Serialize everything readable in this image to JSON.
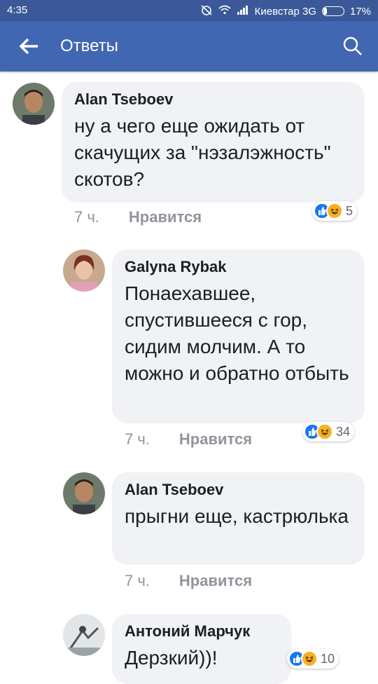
{
  "status": {
    "time": "4:35",
    "carrier": "Киевстар 3G",
    "battery": "17%",
    "battery_level": 0.17
  },
  "header": {
    "title": "Ответы"
  },
  "comments": [
    {
      "author": "Alan Tseboev",
      "text": "ну а чего еще ожидать от скачущих за \"нэзалэжность\" скотов?",
      "time": "7 ч.",
      "like_label": "Нравится",
      "reactions_count": "5"
    },
    {
      "author": "Galyna Rybak",
      "text": "Понаехавшее, спустившееся с гор, сидим молчим. А то можно и обратно отбыть",
      "time": "7 ч.",
      "like_label": "Нравится",
      "reactions_count": "34"
    },
    {
      "author": "Alan Tseboev",
      "text": "прыгни еще, кастрюлька",
      "time": "7 ч.",
      "like_label": "Нравится"
    },
    {
      "author": "Антоний Марчук",
      "text": "Дерзкий))!",
      "reactions_count": "10"
    }
  ]
}
